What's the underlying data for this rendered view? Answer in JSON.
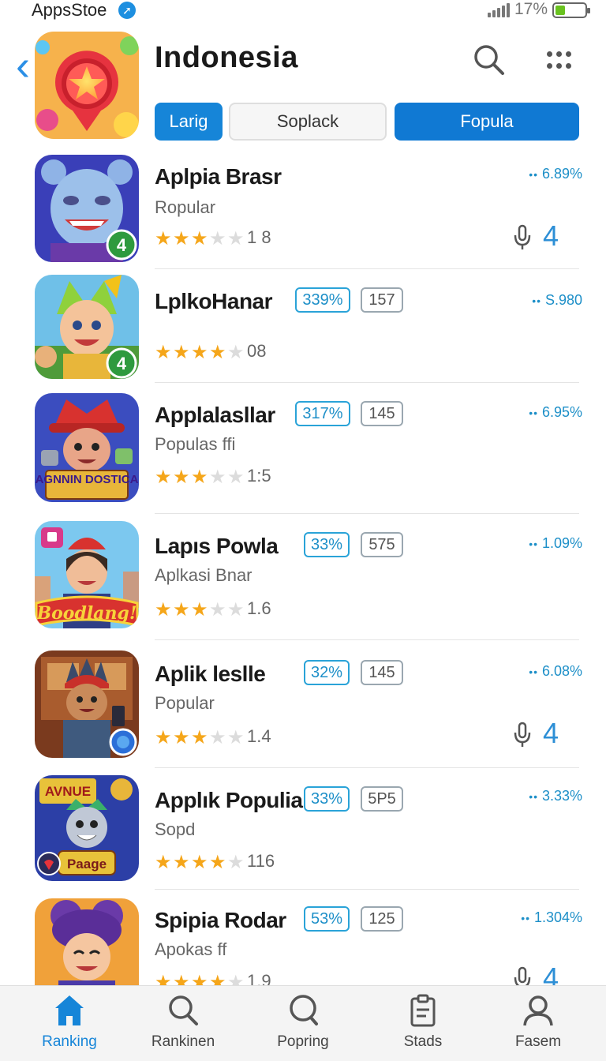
{
  "status_bar": {
    "store_label": "AppsStoe",
    "battery_percent": "17%",
    "battery_level": 0.17
  },
  "header": {
    "title": "Indonesia",
    "tabs": [
      {
        "label": "Larig",
        "state": "active"
      },
      {
        "label": "Soplack",
        "state": "inactive"
      },
      {
        "label": "Fopula",
        "state": "active"
      }
    ]
  },
  "apps": [
    {
      "name": "Aplpia Brasr",
      "subtitle": "Ropular",
      "rating": 3,
      "rating_count": "1 8",
      "metric": "6.89%",
      "badge_percent": "",
      "badge_count": "",
      "trailing_count": "4",
      "icon_badge": "4"
    },
    {
      "name": "LplkoHanar",
      "subtitle": "",
      "rating": 4,
      "rating_count": "08",
      "metric": "S.980",
      "badge_percent": "339%",
      "badge_count": "157",
      "trailing_count": "",
      "icon_badge": "4"
    },
    {
      "name": "Applalasllar",
      "subtitle": "Populas ffi",
      "rating": 3,
      "rating_count": "1:5",
      "metric": "6.95%",
      "badge_percent": "317%",
      "badge_count": "145",
      "trailing_count": "",
      "icon_text": "AGNNIN DOSTICA"
    },
    {
      "name": "Lapıs Powla",
      "subtitle": "Aplkasi Bnar",
      "rating": 3,
      "rating_count": "1.6",
      "metric": "1.09%",
      "badge_percent": "33%",
      "badge_count": "575",
      "trailing_count": "",
      "icon_text": "Boodlang!"
    },
    {
      "name": "Aplik leslle",
      "subtitle": "Popular",
      "rating": 3,
      "rating_count": "1.4",
      "metric": "6.08%",
      "badge_percent": "32%",
      "badge_count": "145",
      "trailing_count": "4"
    },
    {
      "name": "Applık Populia",
      "subtitle": "Sopd",
      "rating": 4,
      "rating_count": "116",
      "metric": "3.33%",
      "badge_percent": "33%",
      "badge_count": "5P5",
      "trailing_count": "",
      "icon_text_top": "AVNUE",
      "icon_text_bottom": "Paage"
    },
    {
      "name": "Spipia Rodar",
      "subtitle": "Apokas ff",
      "rating": 4,
      "rating_count": "1.9",
      "metric": "1.304%",
      "badge_percent": "53%",
      "badge_count": "125",
      "trailing_count": "4"
    }
  ],
  "bottom_nav": [
    {
      "label": "Ranking",
      "icon": "home-icon",
      "active": true
    },
    {
      "label": "Rankinen",
      "icon": "search-icon",
      "active": false
    },
    {
      "label": "Popring",
      "icon": "search-icon",
      "active": false
    },
    {
      "label": "Stads",
      "icon": "clipboard-icon",
      "active": false
    },
    {
      "label": "Fasem",
      "icon": "user-icon",
      "active": false
    }
  ],
  "colors": {
    "accent": "#1685d8",
    "star": "#f5a61a",
    "metric": "#1d8fc8",
    "battery": "#69c21f"
  }
}
